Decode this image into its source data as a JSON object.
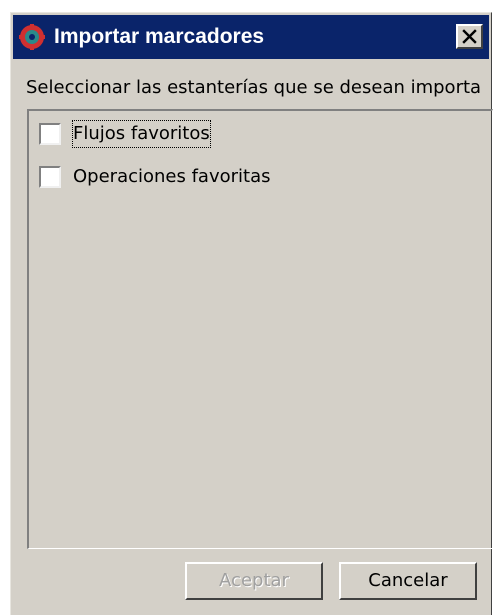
{
  "window": {
    "title": "Importar marcadores",
    "icon": "app-gear-icon",
    "close_icon": "close-icon"
  },
  "instruction": "Seleccionar las estanterías que se desean importa",
  "options": [
    {
      "label": "Flujos favoritos",
      "checked": false,
      "focused": true
    },
    {
      "label": "Operaciones favoritas",
      "checked": false,
      "focused": false
    }
  ],
  "buttons": {
    "accept": {
      "label": "Aceptar",
      "enabled": false
    },
    "cancel": {
      "label": "Cancelar",
      "enabled": true
    }
  },
  "colors": {
    "titlebar": "#0a246a",
    "face": "#d4d0c8",
    "icon_red": "#d03030",
    "icon_teal": "#2a8a8a"
  }
}
